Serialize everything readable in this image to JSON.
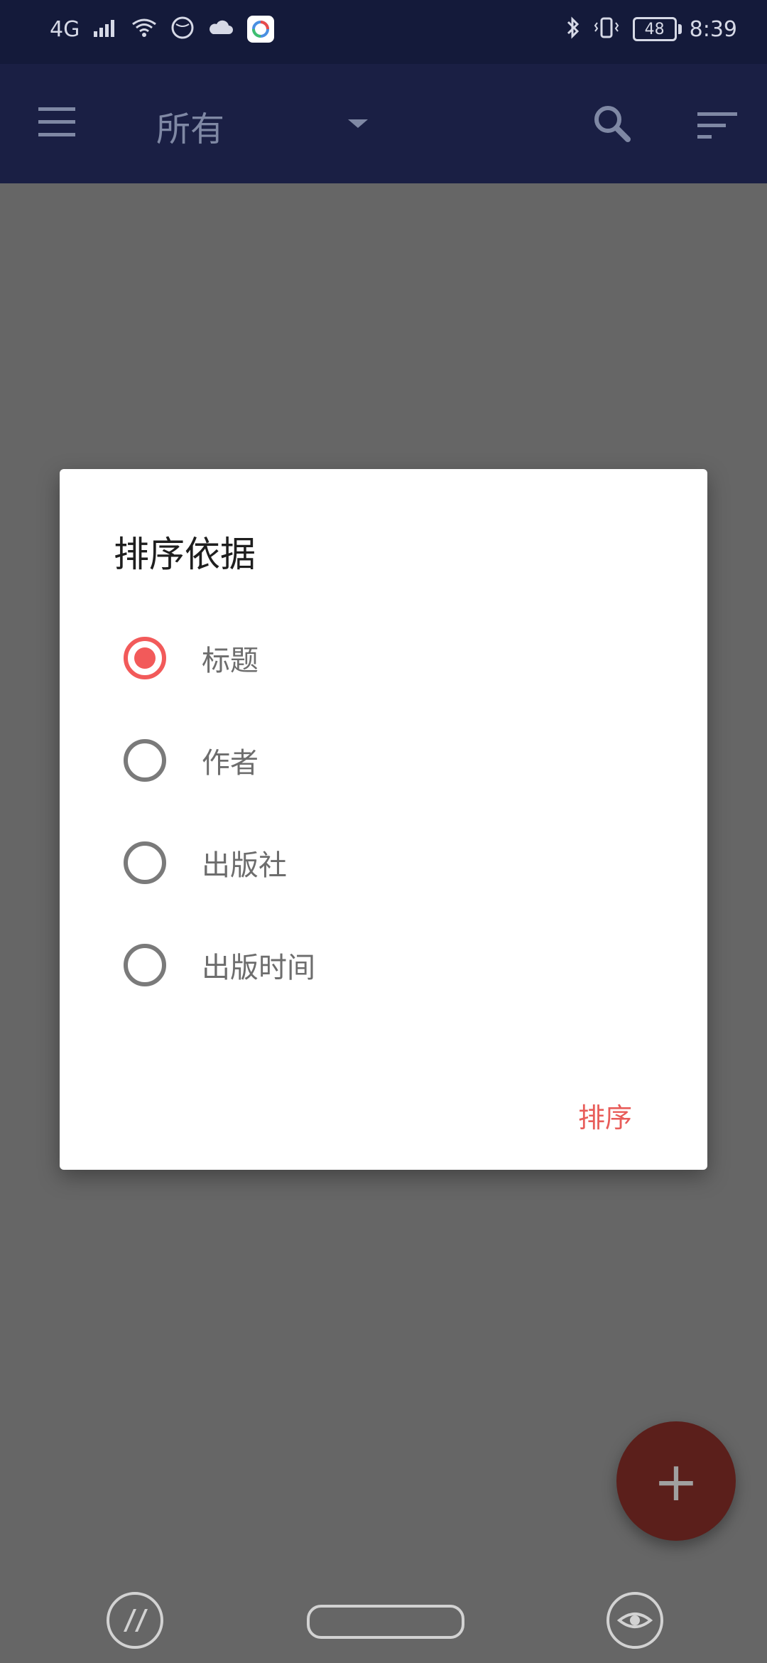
{
  "status_bar": {
    "network": "4G",
    "time": "8:39",
    "battery": "48",
    "icons": [
      "signal-icon",
      "wifi-icon",
      "globe-icon",
      "cloud-icon",
      "app-badge-icon",
      "bluetooth-icon",
      "vibrate-icon",
      "battery-icon"
    ]
  },
  "app_bar": {
    "title": "所有",
    "icons": [
      "menu-icon",
      "dropdown-arrow-icon",
      "search-icon",
      "sort-icon"
    ]
  },
  "dialog": {
    "title": "排序依据",
    "options": [
      {
        "label": "标题",
        "checked": true
      },
      {
        "label": "作者",
        "checked": false
      },
      {
        "label": "出版社",
        "checked": false
      },
      {
        "label": "出版时间",
        "checked": false
      }
    ],
    "action_label": "排序"
  },
  "fab": {
    "symbol": "+"
  },
  "colors": {
    "app_bar_bg": "#1a1f44",
    "status_bar_bg": "#141a3a",
    "overlay_bg": "#666666",
    "accent": "#f25a5a",
    "fab_bg": "#5b1f1b"
  }
}
